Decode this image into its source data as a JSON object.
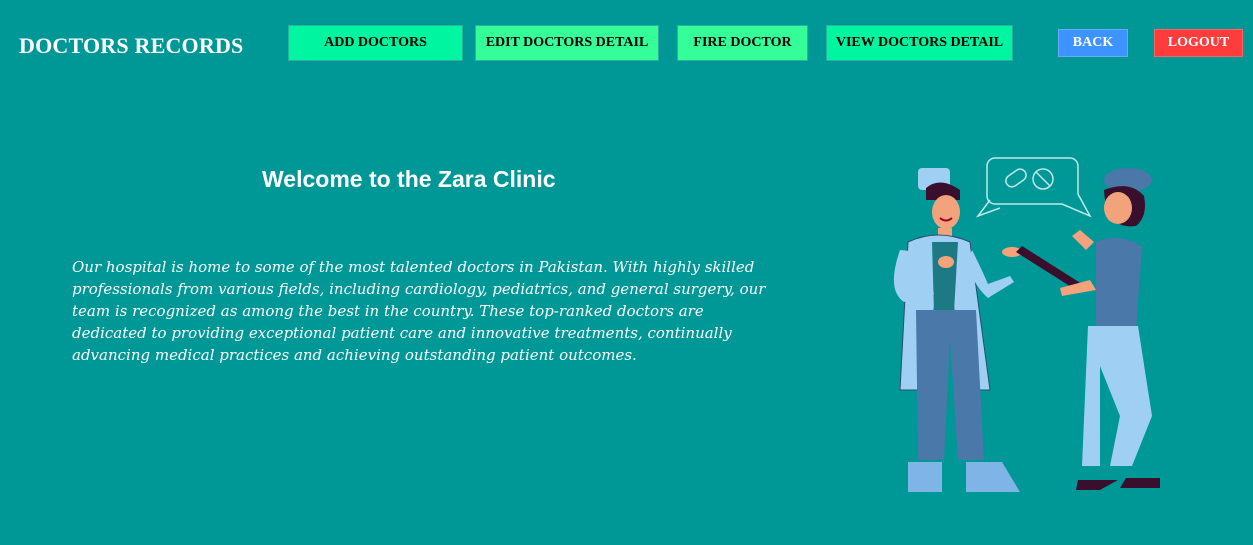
{
  "app": {
    "title": "DOCTORS RECORDS"
  },
  "nav": {
    "add": "ADD DOCTORS",
    "edit": "EDIT DOCTORS DETAIL",
    "fire": "FIRE DOCTOR",
    "view": "VIEW DOCTORS DETAIL",
    "back": "BACK",
    "logout": "LOGOUT"
  },
  "main": {
    "welcome": "Welcome to the Zara Clinic",
    "intro": "Our hospital is home to some of the most talented doctors in Pakistan. With highly skilled professionals from various fields, including cardiology, pediatrics, and general surgery, our team is recognized as among the best in the country. These top-ranked doctors are dedicated to providing exceptional patient care and innovative treatments, continually advancing medical practices and achieving outstanding patient outcomes."
  },
  "colors": {
    "background": "#009797",
    "nav_green": "#00f5a0",
    "back_blue": "#3d93ff",
    "logout_red": "#ff3b3b"
  }
}
